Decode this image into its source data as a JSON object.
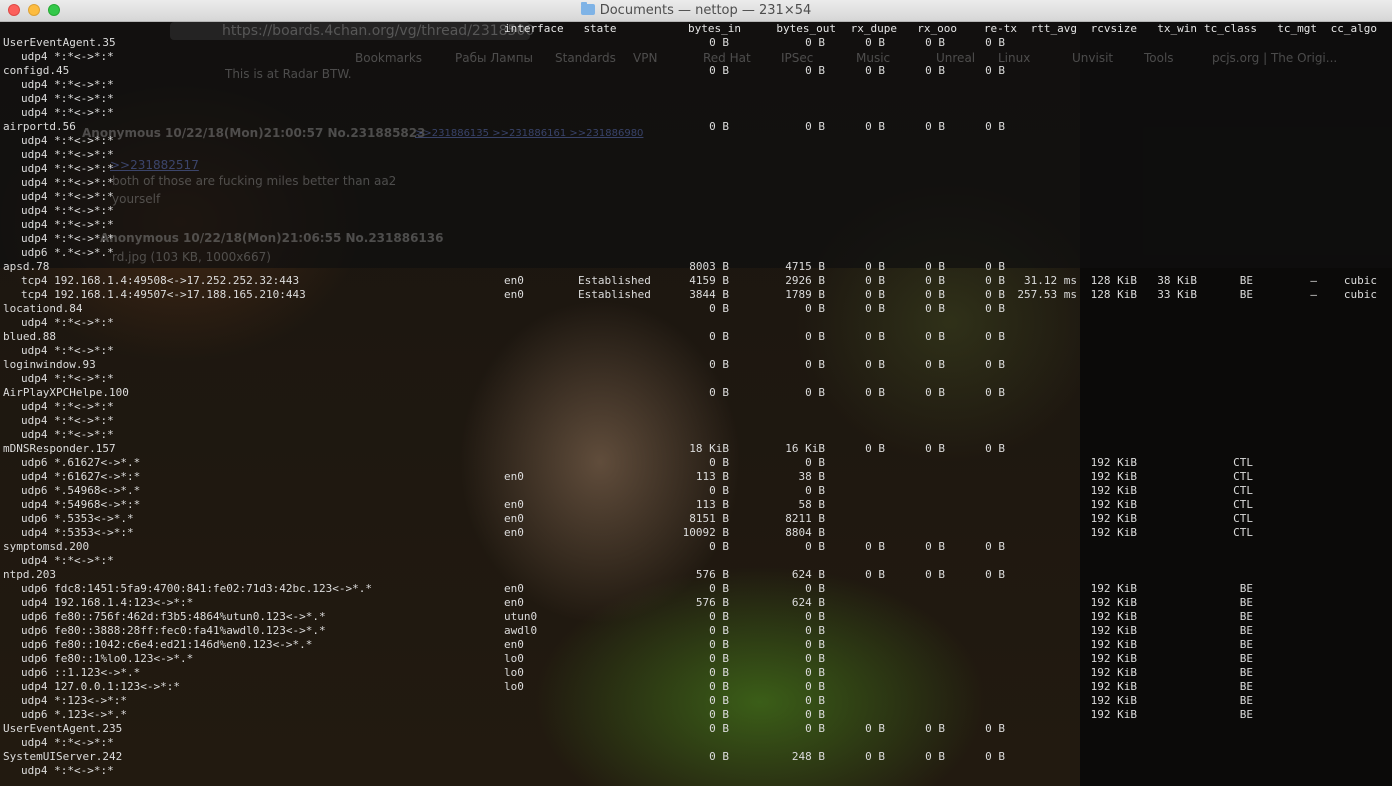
{
  "window": {
    "title": "Documents — nettop — 231×54",
    "folder_icon": "folder-icon",
    "colors": {
      "close": "#fc605c",
      "minimize": "#fdbc40",
      "zoom": "#34c84a"
    }
  },
  "background": {
    "url_text": "https://boards.4chan.org/vg/thread/2318500",
    "bookmarks": [
      "Bookmarks",
      "Рабы Лампы",
      "Standards",
      "VPN",
      "Red Hat",
      "IPSec",
      "Music",
      "Unreal",
      "Linux",
      "Unvisit",
      "Tools",
      "pcjs.org | The Origi..."
    ],
    "lines": [
      "This is at Radar BTW.",
      "Anonymous 10/22/18(Mon)21:00:57 No.231885823",
      ">>231886135 >>231886161 >>231886980",
      ">>231882517",
      "both of those are fucking miles better than aa2",
      "yourself",
      "Anonymous 10/22/18(Mon)21:06:55 No.231886136",
      "rd.jpg (103 KB, 1000x667)"
    ]
  },
  "columns": {
    "interface": "interface",
    "state": "state",
    "bytes_in": "bytes_in",
    "bytes_out": "bytes_out",
    "rx_dupe": "rx_dupe",
    "rx_ooo": "rx_ooo",
    "re_tx": "re-tx",
    "rtt_avg": "rtt_avg",
    "rcvsize": "rcvsize",
    "tx_win": "tx_win",
    "tc_class": "tc_class",
    "tc_mgt": "tc_mgt",
    "cc_algo": "cc_algo"
  },
  "rows": [
    {
      "type": "proc",
      "name": "UserEventAgent.35",
      "bytes_in": "0 B",
      "bytes_out": "0 B",
      "rx_dupe": "0 B",
      "rx_ooo": "0 B",
      "re_tx": "0 B"
    },
    {
      "type": "conn",
      "name": "udp4 *:*<->*:*"
    },
    {
      "type": "proc",
      "name": "configd.45",
      "bytes_in": "0 B",
      "bytes_out": "0 B",
      "rx_dupe": "0 B",
      "rx_ooo": "0 B",
      "re_tx": "0 B"
    },
    {
      "type": "conn",
      "name": "udp4 *:*<->*:*"
    },
    {
      "type": "conn",
      "name": "udp4 *:*<->*:*"
    },
    {
      "type": "conn",
      "name": "udp4 *:*<->*:*"
    },
    {
      "type": "proc",
      "name": "airportd.56",
      "bytes_in": "0 B",
      "bytes_out": "0 B",
      "rx_dupe": "0 B",
      "rx_ooo": "0 B",
      "re_tx": "0 B"
    },
    {
      "type": "conn",
      "name": "udp4 *:*<->*:*"
    },
    {
      "type": "conn",
      "name": "udp4 *:*<->*:*"
    },
    {
      "type": "conn",
      "name": "udp4 *:*<->*:*"
    },
    {
      "type": "conn",
      "name": "udp4 *:*<->*:*"
    },
    {
      "type": "conn",
      "name": "udp4 *:*<->*:*"
    },
    {
      "type": "conn",
      "name": "udp4 *:*<->*:*"
    },
    {
      "type": "conn",
      "name": "udp4 *:*<->*:*"
    },
    {
      "type": "conn",
      "name": "udp4 *:*<->*:*"
    },
    {
      "type": "conn",
      "name": "udp6 *.*<->*.*"
    },
    {
      "type": "proc",
      "name": "apsd.78",
      "bytes_in": "8003 B",
      "bytes_out": "4715 B",
      "rx_dupe": "0 B",
      "rx_ooo": "0 B",
      "re_tx": "0 B"
    },
    {
      "type": "conn",
      "name": "tcp4 192.168.1.4:49508<->17.252.252.32:443",
      "interface": "en0",
      "state": "Established",
      "bytes_in": "4159 B",
      "bytes_out": "2926 B",
      "rx_dupe": "0 B",
      "rx_ooo": "0 B",
      "re_tx": "0 B",
      "rtt_avg": "31.12 ms",
      "rcvsize": "128 KiB",
      "tx_win": "38 KiB",
      "tc_class": "BE",
      "tc_mgt": "–",
      "cc_algo": "cubic"
    },
    {
      "type": "conn",
      "name": "tcp4 192.168.1.4:49507<->17.188.165.210:443",
      "interface": "en0",
      "state": "Established",
      "bytes_in": "3844 B",
      "bytes_out": "1789 B",
      "rx_dupe": "0 B",
      "rx_ooo": "0 B",
      "re_tx": "0 B",
      "rtt_avg": "257.53 ms",
      "rcvsize": "128 KiB",
      "tx_win": "33 KiB",
      "tc_class": "BE",
      "tc_mgt": "–",
      "cc_algo": "cubic"
    },
    {
      "type": "proc",
      "name": "locationd.84",
      "bytes_in": "0 B",
      "bytes_out": "0 B",
      "rx_dupe": "0 B",
      "rx_ooo": "0 B",
      "re_tx": "0 B"
    },
    {
      "type": "conn",
      "name": "udp4 *:*<->*:*"
    },
    {
      "type": "proc",
      "name": "blued.88",
      "bytes_in": "0 B",
      "bytes_out": "0 B",
      "rx_dupe": "0 B",
      "rx_ooo": "0 B",
      "re_tx": "0 B"
    },
    {
      "type": "conn",
      "name": "udp4 *:*<->*:*"
    },
    {
      "type": "proc",
      "name": "loginwindow.93",
      "bytes_in": "0 B",
      "bytes_out": "0 B",
      "rx_dupe": "0 B",
      "rx_ooo": "0 B",
      "re_tx": "0 B"
    },
    {
      "type": "conn",
      "name": "udp4 *:*<->*:*"
    },
    {
      "type": "proc",
      "name": "AirPlayXPCHelpe.100",
      "bytes_in": "0 B",
      "bytes_out": "0 B",
      "rx_dupe": "0 B",
      "rx_ooo": "0 B",
      "re_tx": "0 B"
    },
    {
      "type": "conn",
      "name": "udp4 *:*<->*:*"
    },
    {
      "type": "conn",
      "name": "udp4 *:*<->*:*"
    },
    {
      "type": "conn",
      "name": "udp4 *:*<->*:*"
    },
    {
      "type": "proc",
      "name": "mDNSResponder.157",
      "bytes_in": "18 KiB",
      "bytes_out": "16 KiB",
      "rx_dupe": "0 B",
      "rx_ooo": "0 B",
      "re_tx": "0 B"
    },
    {
      "type": "conn",
      "name": "udp6 *.61627<->*.*",
      "bytes_in": "0 B",
      "bytes_out": "0 B",
      "rcvsize": "192 KiB",
      "tc_class": "CTL"
    },
    {
      "type": "conn",
      "name": "udp4 *:61627<->*:*",
      "interface": "en0",
      "bytes_in": "113 B",
      "bytes_out": "38 B",
      "rcvsize": "192 KiB",
      "tc_class": "CTL"
    },
    {
      "type": "conn",
      "name": "udp6 *.54968<->*.*",
      "bytes_in": "0 B",
      "bytes_out": "0 B",
      "rcvsize": "192 KiB",
      "tc_class": "CTL"
    },
    {
      "type": "conn",
      "name": "udp4 *:54968<->*:*",
      "interface": "en0",
      "bytes_in": "113 B",
      "bytes_out": "58 B",
      "rcvsize": "192 KiB",
      "tc_class": "CTL"
    },
    {
      "type": "conn",
      "name": "udp6 *.5353<->*.*",
      "interface": "en0",
      "bytes_in": "8151 B",
      "bytes_out": "8211 B",
      "rcvsize": "192 KiB",
      "tc_class": "CTL"
    },
    {
      "type": "conn",
      "name": "udp4 *:5353<->*:*",
      "interface": "en0",
      "bytes_in": "10092 B",
      "bytes_out": "8804 B",
      "rcvsize": "192 KiB",
      "tc_class": "CTL"
    },
    {
      "type": "proc",
      "name": "symptomsd.200",
      "bytes_in": "0 B",
      "bytes_out": "0 B",
      "rx_dupe": "0 B",
      "rx_ooo": "0 B",
      "re_tx": "0 B"
    },
    {
      "type": "conn",
      "name": "udp4 *:*<->*:*"
    },
    {
      "type": "proc",
      "name": "ntpd.203",
      "bytes_in": "576 B",
      "bytes_out": "624 B",
      "rx_dupe": "0 B",
      "rx_ooo": "0 B",
      "re_tx": "0 B"
    },
    {
      "type": "conn",
      "name": "udp6 fdc8:1451:5fa9:4700:841:fe02:71d3:42bc.123<->*.*",
      "interface": "en0",
      "bytes_in": "0 B",
      "bytes_out": "0 B",
      "rcvsize": "192 KiB",
      "tc_class": "BE"
    },
    {
      "type": "conn",
      "name": "udp4 192.168.1.4:123<->*:*",
      "interface": "en0",
      "bytes_in": "576 B",
      "bytes_out": "624 B",
      "rcvsize": "192 KiB",
      "tc_class": "BE"
    },
    {
      "type": "conn",
      "name": "udp6 fe80::756f:462d:f3b5:4864%utun0.123<->*.*",
      "interface": "utun0",
      "bytes_in": "0 B",
      "bytes_out": "0 B",
      "rcvsize": "192 KiB",
      "tc_class": "BE"
    },
    {
      "type": "conn",
      "name": "udp6 fe80::3888:28ff:fec0:fa41%awdl0.123<->*.*",
      "interface": "awdl0",
      "bytes_in": "0 B",
      "bytes_out": "0 B",
      "rcvsize": "192 KiB",
      "tc_class": "BE"
    },
    {
      "type": "conn",
      "name": "udp6 fe80::1042:c6e4:ed21:146d%en0.123<->*.*",
      "interface": "en0",
      "bytes_in": "0 B",
      "bytes_out": "0 B",
      "rcvsize": "192 KiB",
      "tc_class": "BE"
    },
    {
      "type": "conn",
      "name": "udp6 fe80::1%lo0.123<->*.*",
      "interface": "lo0",
      "bytes_in": "0 B",
      "bytes_out": "0 B",
      "rcvsize": "192 KiB",
      "tc_class": "BE"
    },
    {
      "type": "conn",
      "name": "udp6 ::1.123<->*.*",
      "interface": "lo0",
      "bytes_in": "0 B",
      "bytes_out": "0 B",
      "rcvsize": "192 KiB",
      "tc_class": "BE"
    },
    {
      "type": "conn",
      "name": "udp4 127.0.0.1:123<->*:*",
      "interface": "lo0",
      "bytes_in": "0 B",
      "bytes_out": "0 B",
      "rcvsize": "192 KiB",
      "tc_class": "BE"
    },
    {
      "type": "conn",
      "name": "udp4 *:123<->*:*",
      "bytes_in": "0 B",
      "bytes_out": "0 B",
      "rcvsize": "192 KiB",
      "tc_class": "BE"
    },
    {
      "type": "conn",
      "name": "udp6 *.123<->*.*",
      "bytes_in": "0 B",
      "bytes_out": "0 B",
      "rcvsize": "192 KiB",
      "tc_class": "BE"
    },
    {
      "type": "proc",
      "name": "UserEventAgent.235",
      "bytes_in": "0 B",
      "bytes_out": "0 B",
      "rx_dupe": "0 B",
      "rx_ooo": "0 B",
      "re_tx": "0 B"
    },
    {
      "type": "conn",
      "name": "udp4 *:*<->*:*"
    },
    {
      "type": "proc",
      "name": "SystemUIServer.242",
      "bytes_in": "0 B",
      "bytes_out": "248 B",
      "rx_dupe": "0 B",
      "rx_ooo": "0 B",
      "re_tx": "0 B"
    },
    {
      "type": "conn",
      "name": "udp4 *:*<->*:*"
    }
  ]
}
